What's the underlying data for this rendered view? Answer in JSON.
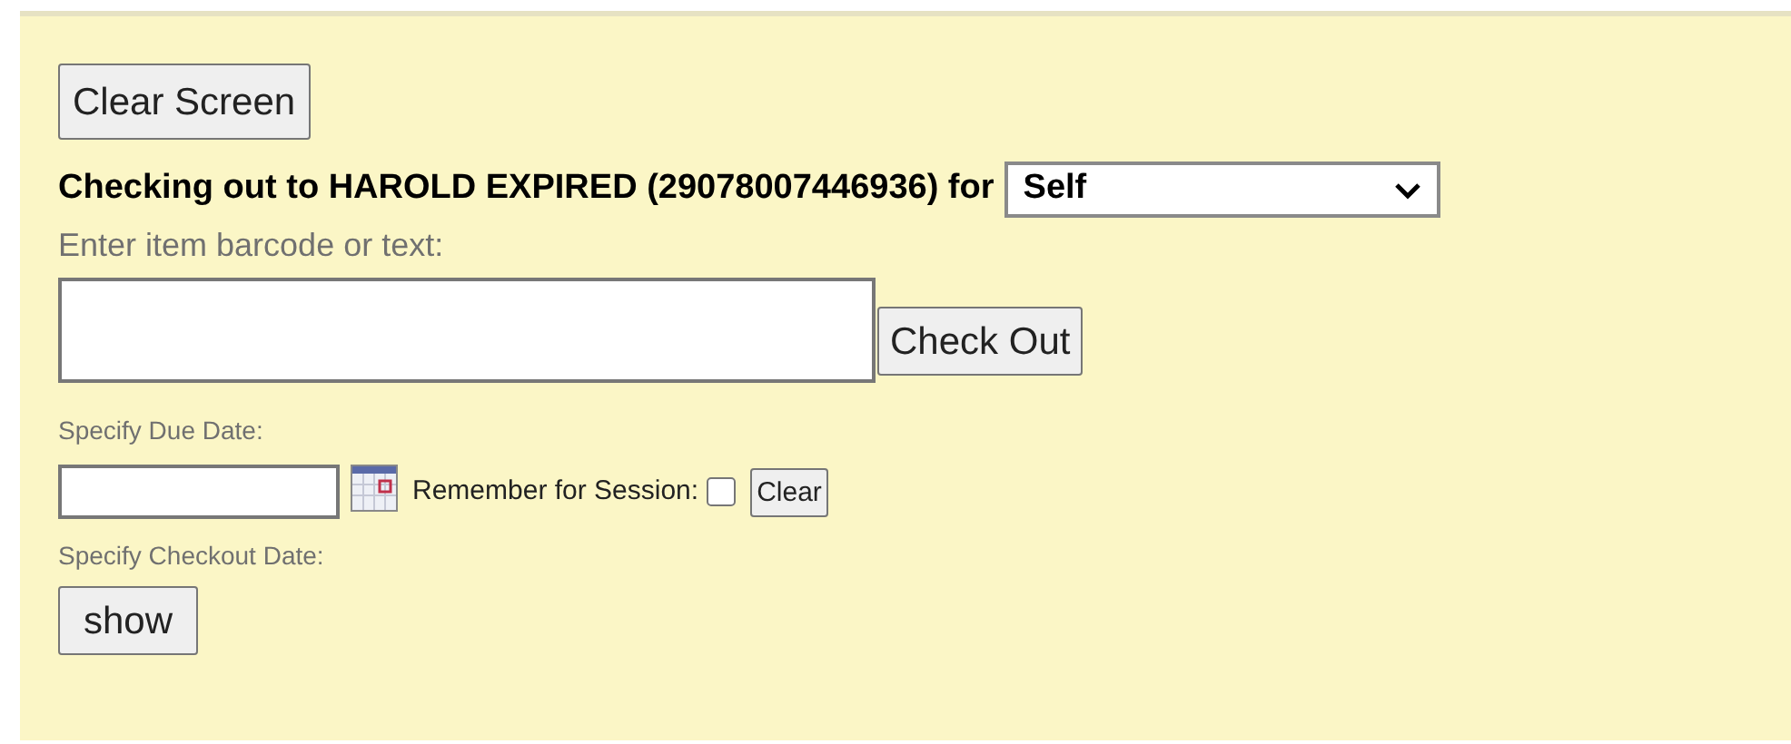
{
  "clear_screen_button": "Clear Screen",
  "heading": "Checking out to HAROLD EXPIRED (29078007446936) for",
  "for_select": {
    "value": "Self"
  },
  "barcode_label": "Enter item barcode or text:",
  "check_out_button": "Check Out",
  "due_date_label": "Specify Due Date:",
  "remember_label": "Remember for Session:",
  "remember_checked": false,
  "clear_button": "Clear",
  "checkout_date_label": "Specify Checkout Date:",
  "show_button": "show"
}
